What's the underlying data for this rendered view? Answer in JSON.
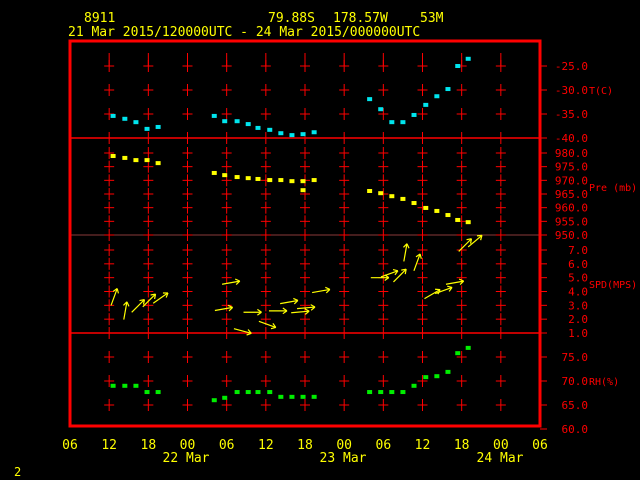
{
  "header": {
    "station": "8911",
    "lat": "79.88S",
    "lon": "178.57W",
    "elev": "53M",
    "period": "21 Mar 2015/120000UTC - 24 Mar 2015/000000UTC"
  },
  "page_number": "2",
  "colors": {
    "frame": "#ff0000",
    "text": "#ffff00",
    "temp": "#00e5ee",
    "pressure": "#ffff00",
    "wind": "#ffff00",
    "rh": "#00ee00"
  },
  "chart_data": [
    {
      "type": "scatter",
      "ylabel": "T(C)",
      "ylim": [
        -40,
        -25
      ],
      "yticks": [
        "-25.0",
        "-30.0",
        "-35.0",
        "-40.0"
      ],
      "ytick_values": [
        -25,
        -30,
        -35,
        -40
      ],
      "x": [
        "2015-03-21T12:36",
        "2015-03-21T14:24",
        "2015-03-21T16:06",
        "2015-03-21T17:48",
        "2015-03-21T19:30",
        "2015-03-22T04:06",
        "2015-03-22T05:42",
        "2015-03-22T07:36",
        "2015-03-22T09:18",
        "2015-03-22T10:48",
        "2015-03-22T12:36",
        "2015-03-22T14:18",
        "2015-03-22T16:00",
        "2015-03-22T17:42",
        "2015-03-22T19:24",
        "2015-03-23T03:54",
        "2015-03-23T05:36",
        "2015-03-23T07:18",
        "2015-03-23T09:00",
        "2015-03-23T10:42",
        "2015-03-23T12:30",
        "2015-03-23T14:12",
        "2015-03-23T15:54",
        "2015-03-23T17:24",
        "2015-03-23T19:00"
      ],
      "values": [
        -35.4,
        -36.0,
        -36.7,
        -38.1,
        -37.7,
        -35.4,
        -36.5,
        -36.5,
        -37.1,
        -37.9,
        -38.3,
        -39.0,
        -39.4,
        -39.2,
        -38.8,
        -31.9,
        -34.0,
        -36.7,
        -36.7,
        -35.2,
        -33.1,
        -31.3,
        -29.8,
        -25.0,
        -23.5
      ]
    },
    {
      "type": "scatter",
      "ylabel": "Pre (mb)",
      "ylim": [
        950,
        980
      ],
      "yticks": [
        "980.0",
        "975.0",
        "970.0",
        "965.0",
        "960.0",
        "955.0",
        "950.0"
      ],
      "ytick_values": [
        980,
        975,
        970,
        965,
        960,
        955,
        950
      ],
      "x": [
        "2015-03-21T12:36",
        "2015-03-21T14:24",
        "2015-03-21T16:06",
        "2015-03-21T17:48",
        "2015-03-21T19:30",
        "2015-03-22T04:06",
        "2015-03-22T05:42",
        "2015-03-22T07:36",
        "2015-03-22T09:18",
        "2015-03-22T10:48",
        "2015-03-22T12:36",
        "2015-03-22T14:18",
        "2015-03-22T16:00",
        "2015-03-22T17:42",
        "2015-03-22T17:42",
        "2015-03-22T19:24",
        "2015-03-23T03:54",
        "2015-03-23T05:36",
        "2015-03-23T07:18",
        "2015-03-23T09:00",
        "2015-03-23T10:42",
        "2015-03-23T12:30",
        "2015-03-23T14:12",
        "2015-03-23T15:54",
        "2015-03-23T17:24",
        "2015-03-23T19:00"
      ],
      "values": [
        978.9,
        978.2,
        977.4,
        977.4,
        976.3,
        972.7,
        971.9,
        971.2,
        970.8,
        970.5,
        970.1,
        970.1,
        969.7,
        969.7,
        966.4,
        970.1,
        966.1,
        965.3,
        964.2,
        963.2,
        961.7,
        959.9,
        958.8,
        957.3,
        955.5,
        954.7
      ]
    },
    {
      "type": "vector",
      "ylabel": "SPD(MPS)",
      "ylim": [
        1,
        7
      ],
      "yticks": [
        "7.0",
        "6.0",
        "5.0",
        "4.0",
        "3.0",
        "2.0",
        "1.0"
      ],
      "ytick_values": [
        7,
        6,
        5,
        4,
        3,
        2,
        1
      ],
      "x": [
        "2015-03-21T12:36",
        "2015-03-21T14:24",
        "2015-03-21T16:06",
        "2015-03-21T17:48",
        "2015-03-21T19:30",
        "2015-03-22T05:06",
        "2015-03-22T06:12",
        "2015-03-22T08:00",
        "2015-03-22T09:30",
        "2015-03-22T11:48",
        "2015-03-22T13:24",
        "2015-03-22T15:06",
        "2015-03-22T16:48",
        "2015-03-22T17:42",
        "2015-03-22T20:00",
        "2015-03-23T05:00",
        "2015-03-23T06:30",
        "2015-03-23T08:12",
        "2015-03-23T09:18",
        "2015-03-23T11:00",
        "2015-03-23T13:06",
        "2015-03-23T14:48",
        "2015-03-23T16:30",
        "2015-03-23T18:12",
        "2015-03-23T19:42"
      ],
      "values": [
        3.4,
        2.4,
        2.8,
        3.2,
        3.4,
        2.7,
        4.6,
        1.2,
        2.5,
        1.7,
        2.6,
        3.2,
        2.5,
        2.8,
        4.0,
        5.0,
        5.2,
        5.0,
        6.6,
        5.9,
        3.7,
        4.0,
        4.6,
        7.2,
        7.5
      ],
      "direction_deg": [
        70,
        80,
        45,
        45,
        35,
        10,
        10,
        -15,
        0,
        -20,
        0,
        10,
        5,
        5,
        10,
        0,
        20,
        45,
        80,
        70,
        30,
        20,
        10,
        45,
        40
      ]
    },
    {
      "type": "scatter",
      "ylabel": "RH(%)",
      "ylim": [
        60,
        75
      ],
      "yticks": [
        "75.0",
        "70.0",
        "65.0",
        "60.0"
      ],
      "ytick_values": [
        75,
        70,
        65,
        60
      ],
      "x": [
        "2015-03-21T12:36",
        "2015-03-21T14:24",
        "2015-03-21T16:06",
        "2015-03-21T17:48",
        "2015-03-21T19:30",
        "2015-03-22T04:06",
        "2015-03-22T05:42",
        "2015-03-22T07:36",
        "2015-03-22T09:18",
        "2015-03-22T10:48",
        "2015-03-22T12:36",
        "2015-03-22T14:18",
        "2015-03-22T16:00",
        "2015-03-22T17:42",
        "2015-03-22T19:24",
        "2015-03-23T03:54",
        "2015-03-23T05:36",
        "2015-03-23T07:18",
        "2015-03-23T09:00",
        "2015-03-23T10:42",
        "2015-03-23T12:30",
        "2015-03-23T14:12",
        "2015-03-23T15:54",
        "2015-03-23T17:24",
        "2015-03-23T19:00"
      ],
      "values": [
        69.0,
        69.0,
        69.0,
        67.7,
        67.7,
        66.0,
        66.5,
        67.7,
        67.7,
        67.7,
        67.7,
        66.7,
        66.7,
        66.7,
        66.7,
        67.7,
        67.7,
        67.7,
        67.7,
        69.0,
        70.8,
        71.0,
        71.9,
        75.8,
        76.9
      ]
    }
  ],
  "xaxis": {
    "range": [
      "2015-03-21T06:00",
      "2015-03-24T06:00"
    ],
    "tick_labels": [
      "06",
      "12",
      "18",
      "00",
      "06",
      "12",
      "18",
      "00",
      "06",
      "12",
      "18",
      "00",
      "06"
    ],
    "date_labels": [
      "22 Mar",
      "23 Mar",
      "24 Mar"
    ]
  }
}
